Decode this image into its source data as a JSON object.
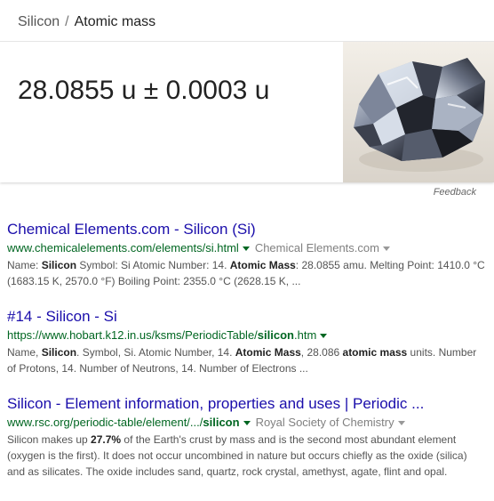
{
  "knowledge_card": {
    "breadcrumb_entity": "Silicon",
    "breadcrumb_separator": "/",
    "breadcrumb_attribute": "Atomic mass",
    "answer": "28.0855 u ± 0.0003 u",
    "image_icon": "silicon-chunk-photo",
    "feedback_label": "Feedback"
  },
  "results": [
    {
      "title": "Chemical Elements.com - Silicon (Si)",
      "url": "www.chemicalelements.com/elements/si.html",
      "site_name": "Chemical Elements.com",
      "snippet": [
        {
          "t": "Name: ",
          "b": false
        },
        {
          "t": "Silicon",
          "b": true
        },
        {
          "t": " Symbol: Si Atomic Number: 14. ",
          "b": false
        },
        {
          "t": "Atomic Mass",
          "b": true
        },
        {
          "t": ": 28.0855 amu. Melting Point: 1410.0 °C (1683.15 K, 2570.0 °F) Boiling Point: 2355.0 °C (2628.15 K, ...",
          "b": false
        }
      ]
    },
    {
      "title": "#14 - Silicon - Si",
      "url_prefix": "https://www.hobart.k12.in.us/ksms/PeriodicTable/",
      "url_bold": "silicon",
      "url_suffix": ".htm",
      "snippet": [
        {
          "t": "Name, ",
          "b": false
        },
        {
          "t": "Silicon",
          "b": true
        },
        {
          "t": ". Symbol, Si. Atomic Number, 14. ",
          "b": false
        },
        {
          "t": "Atomic Mass",
          "b": true
        },
        {
          "t": ", 28.086 ",
          "b": false
        },
        {
          "t": "atomic mass",
          "b": true
        },
        {
          "t": " units. Number of Protons, 14. Number of Neutrons, 14. Number of Electrons ...",
          "b": false
        }
      ]
    },
    {
      "title": "Silicon - Element information, properties and uses | Periodic ...",
      "url_prefix": "www.rsc.org/periodic-table/element/.../",
      "url_bold": "silicon",
      "site_name": "Royal Society of Chemistry",
      "snippet": [
        {
          "t": "Silicon makes up ",
          "b": false
        },
        {
          "t": "27.7%",
          "b": true
        },
        {
          "t": " of the Earth's crust by mass and is the second most abundant element (oxygen is the first). It does not occur uncombined in nature but occurs chiefly as the oxide (silica) and as silicates. The oxide includes sand, quartz, rock crystal, amethyst, agate, flint and opal.",
          "b": false
        }
      ]
    }
  ]
}
